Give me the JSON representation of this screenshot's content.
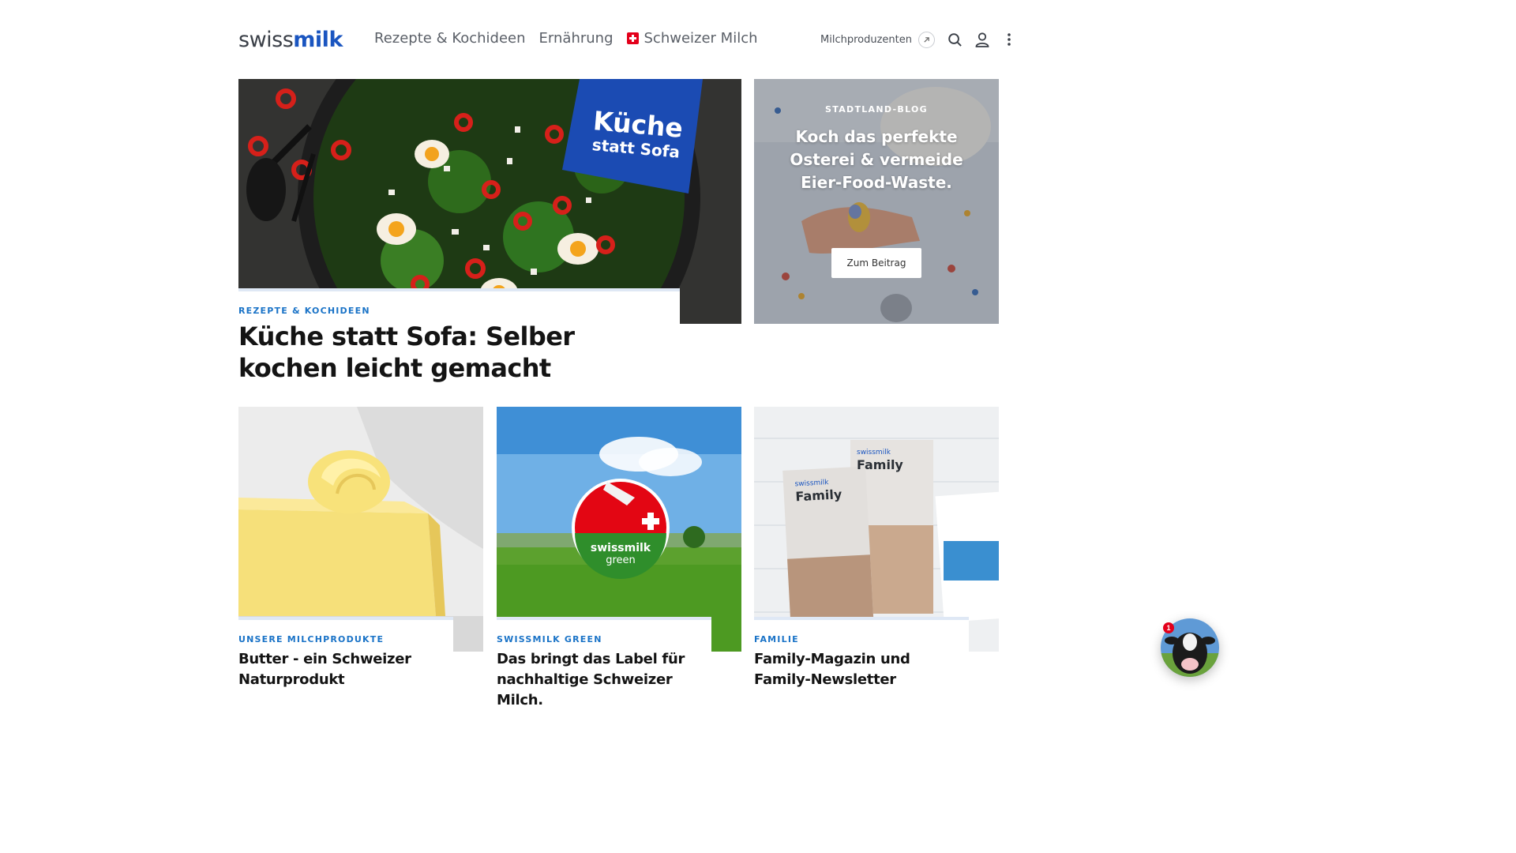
{
  "header": {
    "logo": {
      "part1": "swiss",
      "part2": "milk"
    },
    "nav": [
      {
        "label": "Rezepte & Kochideen"
      },
      {
        "label": "Ernährung"
      },
      {
        "label": "Schweizer Milch"
      }
    ],
    "external_link": "Milchproduzenten"
  },
  "hero": {
    "kicker": "REZEPTE & KOCHIDEEN",
    "title": "Küche statt Sofa: Selber kochen leicht gemacht",
    "badge_line1": "Küche",
    "badge_line2": "statt Sofa"
  },
  "blog": {
    "kicker": "STADTLAND-BLOG",
    "title": "Koch das perfekte Osterei & vermeide Eier-Food-Waste.",
    "button": "Zum Beitrag"
  },
  "cards": [
    {
      "kicker": "UNSERE MILCHPRODUKTE",
      "title": "Butter - ein Schweizer Naturprodukt"
    },
    {
      "kicker": "SWISSMILK GREEN",
      "title": "Das bringt das Label für nachhaltige Schweizer Milch.",
      "logo_line1": "swissmilk",
      "logo_line2": "green"
    },
    {
      "kicker": "FAMILIE",
      "title": "Family-Magazin und Family-Newsletter",
      "mag_brand": "swissmilk",
      "mag_title": "Family"
    }
  ],
  "chat": {
    "badge": "1"
  },
  "colors": {
    "brand_blue": "#1a55c0",
    "kicker_blue": "#1a73c7",
    "swiss_red": "#e3001b"
  },
  "icons": [
    "arrow-up-right-icon",
    "search-icon",
    "user-icon",
    "more-vertical-icon"
  ]
}
